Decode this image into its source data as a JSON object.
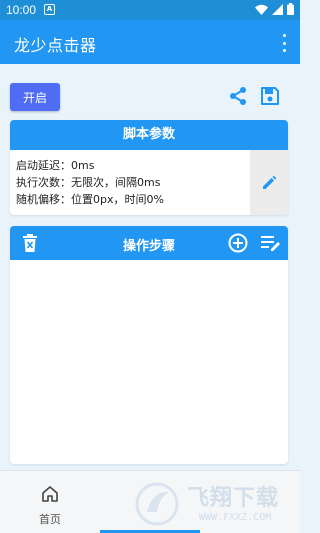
{
  "status_bar": {
    "time": "10:00",
    "notification_glyph": "A"
  },
  "app_bar": {
    "title": "龙少点击器",
    "menu_icon": "more-vert-icon"
  },
  "toolbar": {
    "start_label": "开启",
    "share_icon": "share-icon",
    "save_icon": "save-icon"
  },
  "params": {
    "title": "脚本参数",
    "lines": [
      "启动延迟：0ms",
      "执行次数：无限次，间隔0ms",
      "随机偏移：位置0px，时间0%"
    ],
    "edit_icon": "pencil-icon"
  },
  "steps": {
    "title": "操作步骤",
    "delete_icon": "trash-icon",
    "add_icon": "add-circle-icon",
    "edit_icon": "playlist-edit-icon",
    "items": []
  },
  "bottom_nav": {
    "items": [
      {
        "label": "首页",
        "icon": "home-icon"
      }
    ]
  },
  "colors": {
    "primary": "#2196f3",
    "status_bar": "#1e8fd6",
    "start_button": "#4f6cf4",
    "background": "#e8f3fb"
  },
  "watermark": {
    "brand": "飞翔下载",
    "url": "WWW.FXXZ.COM"
  }
}
